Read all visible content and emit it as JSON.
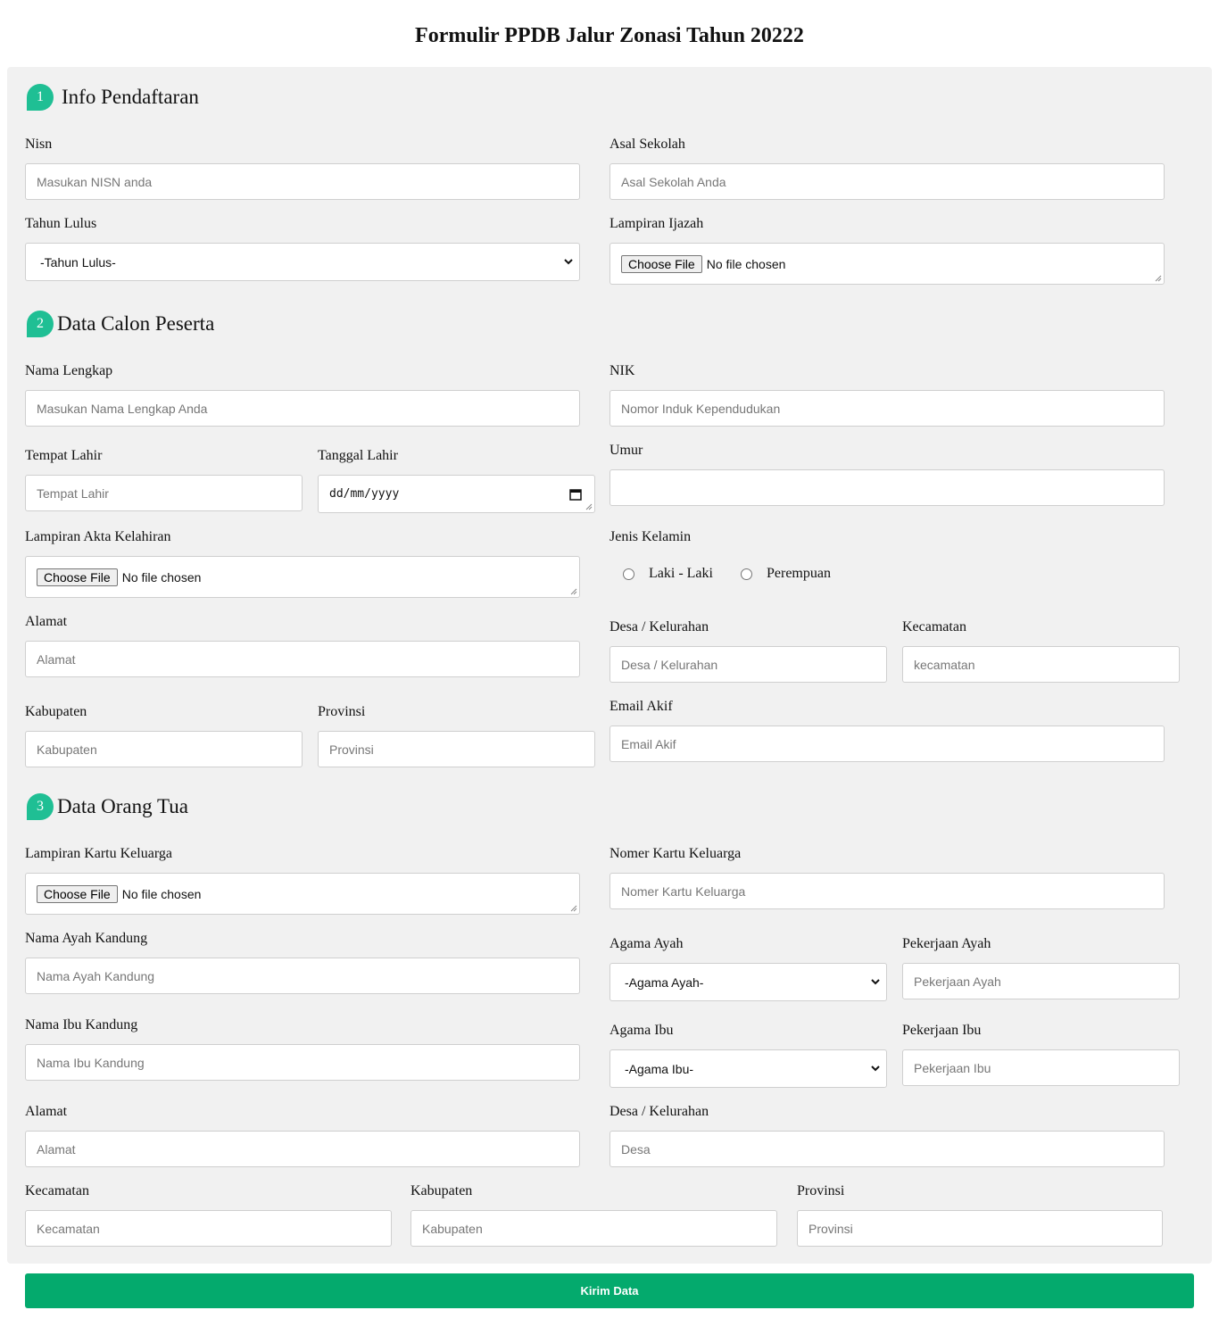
{
  "page_title": "Formulir PPDB Jalur Zonasi Tahun 20222",
  "sections": {
    "s1": {
      "number": "1",
      "title": "Info Pendaftaran"
    },
    "s2": {
      "number": "2",
      "title": "Data Calon Peserta"
    },
    "s3": {
      "number": "3",
      "title": "Data Orang Tua"
    }
  },
  "file_input": {
    "button": "Choose File",
    "status": "No file chosen"
  },
  "s1": {
    "nisn": {
      "label": "Nisn",
      "placeholder": "Masukan NISN anda"
    },
    "asal_sekolah": {
      "label": "Asal Sekolah",
      "placeholder": "Asal Sekolah Anda"
    },
    "tahun_lulus": {
      "label": "Tahun Lulus",
      "selected": "-Tahun Lulus-"
    },
    "lampiran_ijazah": {
      "label": "Lampiran Ijazah"
    }
  },
  "s2": {
    "nama_lengkap": {
      "label": "Nama Lengkap",
      "placeholder": "Masukan Nama Lengkap Anda"
    },
    "nik": {
      "label": "NIK",
      "placeholder": "Nomor Induk Kependudukan"
    },
    "tempat_lahir": {
      "label": "Tempat Lahir",
      "placeholder": "Tempat Lahir"
    },
    "tanggal_lahir": {
      "label": "Tanggal Lahir",
      "value": "dd/mm/yyyy"
    },
    "umur": {
      "label": "Umur",
      "placeholder": ""
    },
    "lampiran_akta": {
      "label": "Lampiran Akta Kelahiran"
    },
    "jenis_kelamin": {
      "label": "Jenis Kelamin",
      "options": [
        "Laki - Laki",
        "Perempuan"
      ]
    },
    "alamat": {
      "label": "Alamat",
      "placeholder": "Alamat"
    },
    "desa": {
      "label": "Desa / Kelurahan",
      "placeholder": "Desa / Kelurahan"
    },
    "kecamatan": {
      "label": "Kecamatan",
      "placeholder": "kecamatan"
    },
    "kabupaten": {
      "label": "Kabupaten",
      "placeholder": "Kabupaten"
    },
    "provinsi": {
      "label": "Provinsi",
      "placeholder": "Provinsi"
    },
    "email": {
      "label": "Email Akif",
      "placeholder": "Email Akif"
    }
  },
  "s3": {
    "lampiran_kk": {
      "label": "Lampiran Kartu Keluarga"
    },
    "nomer_kk": {
      "label": "Nomer Kartu Keluarga",
      "placeholder": "Nomer Kartu Keluarga"
    },
    "nama_ayah": {
      "label": "Nama Ayah Kandung",
      "placeholder": "Nama Ayah Kandung"
    },
    "agama_ayah": {
      "label": "Agama Ayah",
      "selected": "-Agama Ayah-"
    },
    "pekerjaan_ayah": {
      "label": "Pekerjaan Ayah",
      "placeholder": "Pekerjaan Ayah"
    },
    "nama_ibu": {
      "label": "Nama Ibu Kandung",
      "placeholder": "Nama Ibu Kandung"
    },
    "agama_ibu": {
      "label": "Agama Ibu",
      "selected": "-Agama Ibu-"
    },
    "pekerjaan_ibu": {
      "label": "Pekerjaan Ibu",
      "placeholder": "Pekerjaan Ibu"
    },
    "alamat": {
      "label": "Alamat",
      "placeholder": "Alamat"
    },
    "desa": {
      "label": "Desa / Kelurahan",
      "placeholder": "Desa"
    },
    "kecamatan": {
      "label": "Kecamatan",
      "placeholder": "Kecamatan"
    },
    "kabupaten": {
      "label": "Kabupaten",
      "placeholder": "Kabupaten"
    },
    "provinsi": {
      "label": "Provinsi",
      "placeholder": "Provinsi"
    }
  },
  "submit_label": "Kirim Data",
  "colors": {
    "accent": "#1fbf94",
    "submit": "#04aa6d",
    "panel": "#f1f1f1"
  }
}
